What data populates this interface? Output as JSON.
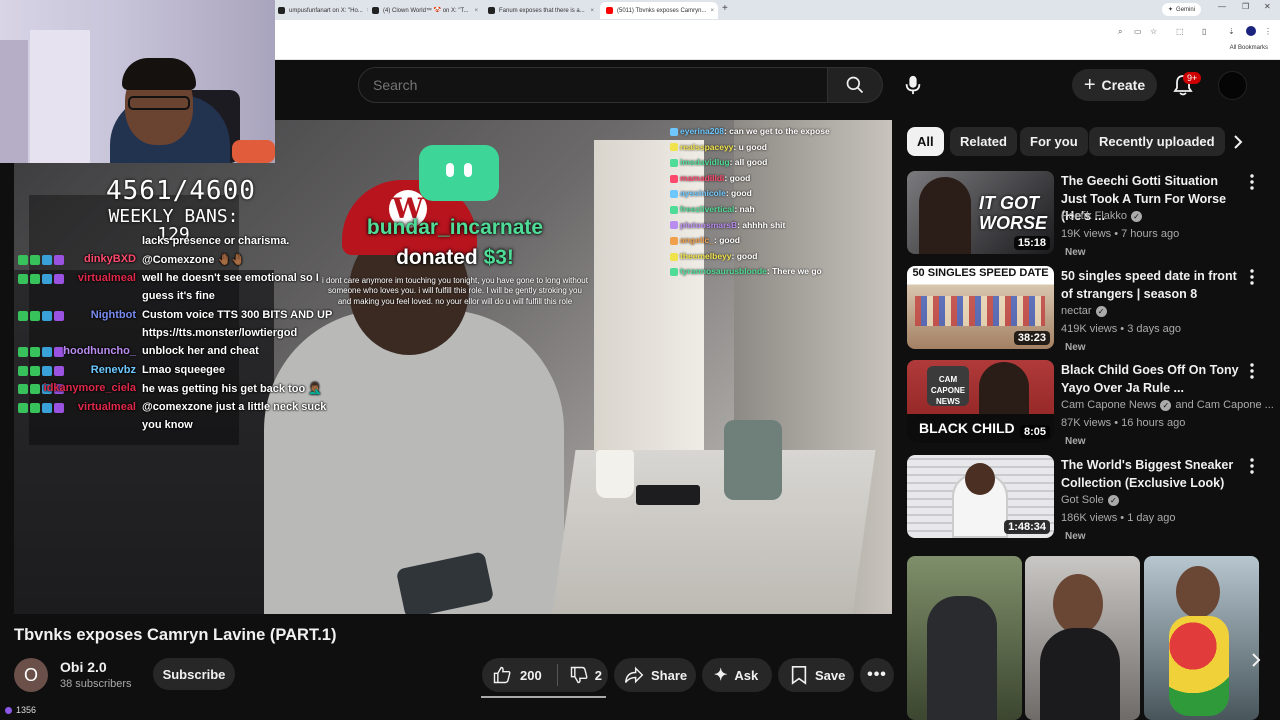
{
  "browser": {
    "tabs": [
      {
        "label": "umpusfunfanart on X: \"Ho...",
        "active": false
      },
      {
        "label": "(4) Clown World™ 🤡 on X: \"T...",
        "active": false
      },
      {
        "label": "Fanum exposes that there is a...",
        "active": false
      },
      {
        "label": "(5011) Tbvnks exposes Camryn...",
        "active": true
      }
    ],
    "new_tab": "+",
    "gemini_label": "Gemini",
    "all_bookmarks": "All Bookmarks"
  },
  "header": {
    "search_placeholder": "Search",
    "create_label": "Create",
    "notifications_count": "9+"
  },
  "stream_overlay": {
    "ban_count": "4561/4600",
    "weekly_bans": "WEEKLY BANS: 129",
    "chat": [
      {
        "name": "",
        "name_color": "#ffffff",
        "message": "lacks presence or charisma."
      },
      {
        "name": "dinkyBXD",
        "name_color": "#ff4a6e",
        "message": "@Comexzone 🤚🏾🤚🏾"
      },
      {
        "name": "virtualmeal",
        "name_color": "#e0284a",
        "message": "well he doesn't see emotional so I"
      },
      {
        "name": "",
        "name_color": "#ffffff",
        "message": "guess it's fine"
      },
      {
        "name": "Nightbot",
        "name_color": "#7a8cf0",
        "message": "Custom voice TTS 300 BITS AND UP"
      },
      {
        "name": "",
        "name_color": "#ffffff",
        "message": "https://tts.monster/lowtiergod"
      },
      {
        "name": "hoodhuncho_",
        "name_color": "#b98cf0",
        "message": "unblock her and cheat"
      },
      {
        "name": "Renevbz",
        "name_color": "#6ec8ff",
        "message": "Lmao squeegee"
      },
      {
        "name": "idkanymore_ciela",
        "name_color": "#e0284a",
        "message": "he was getting his get back too 🤦🏾‍♂️"
      },
      {
        "name": "virtualmeal",
        "name_color": "#e0284a",
        "message": "@comexzone just a little neck suck"
      },
      {
        "name": "",
        "name_color": "#ffffff",
        "message": "you know"
      }
    ],
    "right_chat": [
      {
        "name": "eyerina208",
        "name_color": "#6ec8ff",
        "message": "can we get to the expose"
      },
      {
        "name": "realsspaceyy",
        "name_color": "#f0e24a",
        "message": "u good"
      },
      {
        "name": "imsdavidlug",
        "name_color": "#4fdc96",
        "message": "all good"
      },
      {
        "name": "mamadilldi",
        "name_color": "#ff4a6e",
        "message": "good"
      },
      {
        "name": "ayssinicole",
        "name_color": "#6ec8ff",
        "message": "good"
      },
      {
        "name": "freezlivertical",
        "name_color": "#4fdc96",
        "message": "nah"
      },
      {
        "name": "plutoosmarsB",
        "name_color": "#b98cf0",
        "message": "ahhhh shit"
      },
      {
        "name": "angelic_",
        "name_color": "#f0a04a",
        "message": "good"
      },
      {
        "name": "theemelbeyy",
        "name_color": "#f0e24a",
        "message": "good"
      },
      {
        "name": "tyrannosaurusblonde",
        "name_color": "#4fdc96",
        "message": "There we go"
      }
    ],
    "donation": {
      "name": "bundar_incarnate",
      "prefix": "donated ",
      "amount": "$3!",
      "message": "i dont care anymore im touching you tonight, you have gone to long without someone who loves you. i will fulfill this role. I will be gently stroking you and making you feel loved. no your ellor will do u will fulfill this role"
    }
  },
  "video": {
    "title": "Tbvnks exposes Camryn Lavine (PART.1)",
    "channel_initial": "O",
    "channel_name": "Obi 2.0",
    "subscribers": "38 subscribers",
    "subscribe_label": "Subscribe",
    "likes": "200",
    "dislikes": "2",
    "share_label": "Share",
    "ask_label": "Ask",
    "save_label": "Save",
    "view_badge": "1356"
  },
  "chips": [
    {
      "label": "All",
      "selected": true
    },
    {
      "label": "Related",
      "selected": false
    },
    {
      "label": "For you",
      "selected": false
    },
    {
      "label": "Recently uploaded",
      "selected": false
    }
  ],
  "recommendations": [
    {
      "title": "The Geechi Gotti Situation Just Took A Turn For Worse (He's ...",
      "channel": "Poetik Flakko",
      "verified": true,
      "meta": "19K views • 7 hours ago",
      "duration": "15:18",
      "badge": "New",
      "thumb_text": "IT GOT WORSE"
    },
    {
      "title": "50 singles speed date in front of strangers | season 8",
      "channel": "nectar",
      "verified": true,
      "meta": "419K views • 3 days ago",
      "duration": "38:23",
      "badge": "New",
      "thumb_text": "50 SINGLES SPEED DATE"
    },
    {
      "title": "Black Child Goes Off On Tony Yayo Over Ja Rule ...",
      "channel": "Cam Capone News",
      "verified": true,
      "channel_suffix": "and Cam Capone ...",
      "meta": "87K views • 16 hours ago",
      "duration": "8:05",
      "badge": "New",
      "thumb_text": "BLACK CHILD"
    },
    {
      "title": "The World's Biggest Sneaker Collection (Exclusive Look)",
      "channel": "Got Sole",
      "verified": true,
      "meta": "186K views • 1 day ago",
      "duration": "1:48:34",
      "badge": "New",
      "thumb_text": ""
    }
  ],
  "colors": {
    "background": "#0f0f0f",
    "surface": "#272727",
    "accent_red": "#cc0000",
    "donation_green": "#4fdc96"
  }
}
